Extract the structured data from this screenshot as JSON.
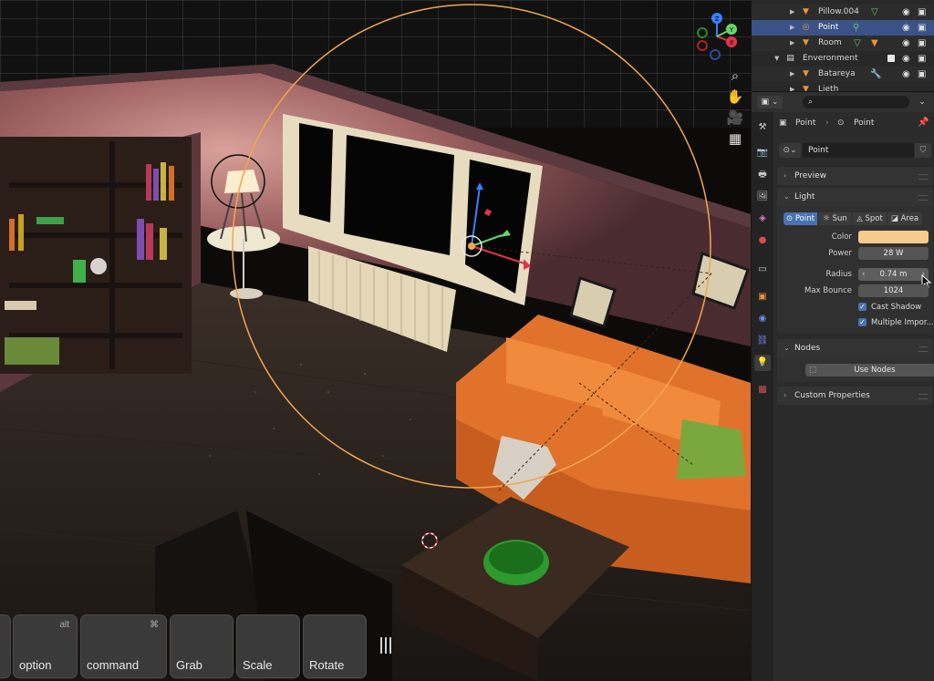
{
  "outliner": {
    "rows": [
      {
        "name": "Pillow.004",
        "kind": "mesh",
        "modifier": "vertex-groups-icon"
      },
      {
        "name": "Point",
        "kind": "light",
        "modifier": "light-data-icon",
        "selected": true
      },
      {
        "name": "Room",
        "kind": "mesh",
        "modifier": "mesh-data-icon"
      },
      {
        "name": "Enveronment",
        "kind": "collection"
      },
      {
        "name": "Batareya",
        "kind": "mesh",
        "modifier": "wrench-icon"
      },
      {
        "name": "Lieth",
        "kind": "mesh"
      }
    ]
  },
  "properties": {
    "breadcrumb": {
      "object": "Point",
      "data": "Point"
    },
    "datablock_name": "Point",
    "panels": {
      "preview": "Preview",
      "light": "Light",
      "nodes": "Nodes",
      "custom": "Custom Properties"
    },
    "light_types": [
      "Point",
      "Sun",
      "Spot",
      "Area"
    ],
    "active_light_type": "Point",
    "fields": {
      "color_label": "Color",
      "color_value": "#f6cc8d",
      "power_label": "Power",
      "power_value": "28 W",
      "radius_label": "Radius",
      "radius_value": "0.74 m",
      "max_bounce_label": "Max Bounce",
      "max_bounce_value": "1024",
      "cast_shadow": "Cast Shadow",
      "multiple_importance": "Multiple Impor..."
    },
    "use_nodes": "Use Nodes"
  },
  "keys": [
    {
      "label": "",
      "mod": ""
    },
    {
      "label": "option",
      "mod": "alt"
    },
    {
      "label": "command",
      "mod": "⌘"
    },
    {
      "label": "Grab",
      "mod": ""
    },
    {
      "label": "Scale",
      "mod": ""
    },
    {
      "label": "Rotate",
      "mod": ""
    }
  ],
  "gizmo": {
    "axes": [
      "X",
      "Y",
      "Z"
    ]
  },
  "colors": {
    "accent": "#4772b3",
    "light_circle": "#f2a64b",
    "selected_row": "#3a5287"
  }
}
